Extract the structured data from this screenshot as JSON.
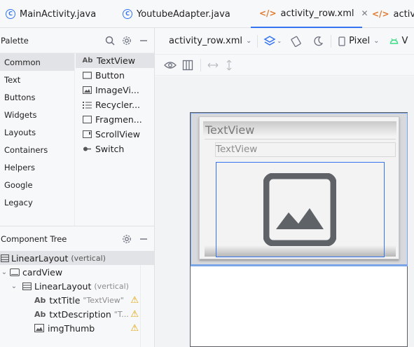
{
  "tabs": [
    {
      "label": "MainActivity.java",
      "icon": "java-class-icon",
      "active": false
    },
    {
      "label": "YoutubeAdapter.java",
      "icon": "java-class-icon",
      "active": false
    },
    {
      "label": "activity_row.xml",
      "icon": "xml-icon",
      "active": true,
      "close": "✕"
    },
    {
      "label": "activity",
      "icon": "xml-icon",
      "active": false
    }
  ],
  "palette": {
    "title": "Palette",
    "categories": [
      "Common",
      "Text",
      "Buttons",
      "Widgets",
      "Layouts",
      "Containers",
      "Helpers",
      "Google",
      "Legacy"
    ],
    "items": [
      {
        "icon": "Ab",
        "label": "TextView"
      },
      {
        "icon": "button-icon",
        "label": "Button"
      },
      {
        "icon": "image-icon",
        "label": "ImageVi..."
      },
      {
        "icon": "list-icon",
        "label": "Recycler..."
      },
      {
        "icon": "fragment-icon",
        "label": "Fragmen..."
      },
      {
        "icon": "scroll-icon",
        "label": "ScrollView"
      },
      {
        "icon": "switch-icon",
        "label": "Switch"
      }
    ]
  },
  "tree": {
    "title": "Component Tree",
    "rows": [
      {
        "label": "LinearLayout",
        "hint": "(vertical)",
        "indent": 0
      },
      {
        "label": "cardView",
        "hint": "",
        "indent": 1
      },
      {
        "label": "LinearLayout",
        "hint": "(vertical)",
        "indent": 2
      },
      {
        "label": "txtTitle",
        "hint": "\"TextView\"",
        "indent": 3,
        "warning": true
      },
      {
        "label": "txtDescription",
        "hint": "\"T...",
        "indent": 3,
        "warning": true
      },
      {
        "label": "imgThumb",
        "hint": "",
        "indent": 3,
        "warning": true
      }
    ]
  },
  "design_toolbar": {
    "file": "activity_row.xml",
    "device": "Pixel",
    "api": "V"
  },
  "preview": {
    "title_text": "TextView",
    "desc_text": "TextView"
  },
  "colors": {
    "accent": "#3574f0",
    "warning": "#e6a200",
    "xml_icon": "#e0782c"
  }
}
